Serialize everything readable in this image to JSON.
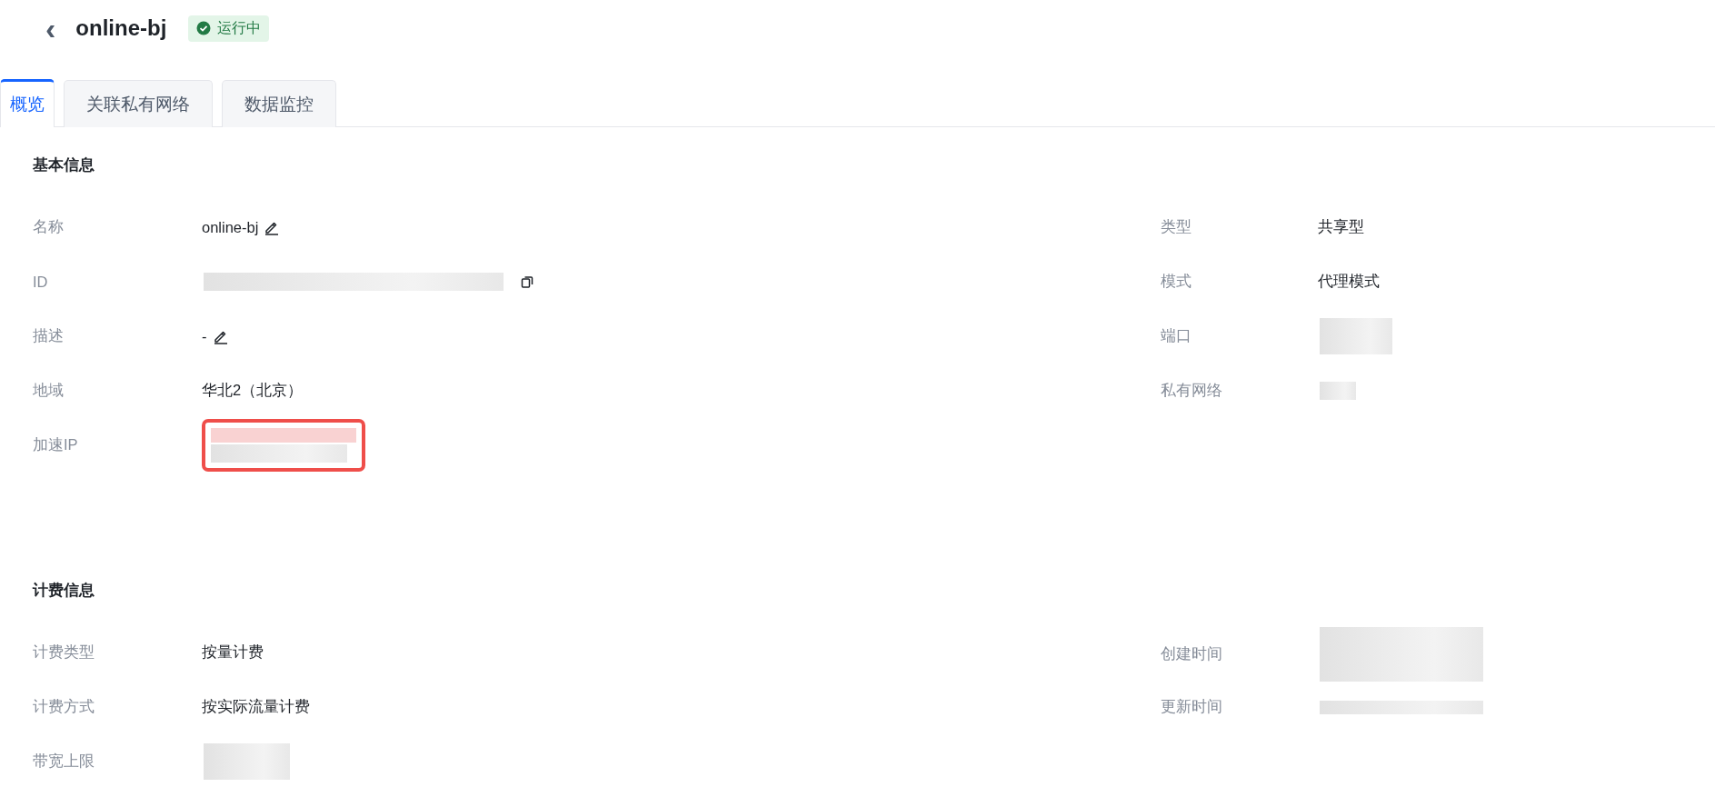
{
  "header": {
    "back": "‹",
    "title": "online-bj",
    "status": {
      "label": "运行中",
      "running": true
    }
  },
  "tabs": [
    {
      "label": "概览",
      "selected": true
    },
    {
      "label": "关联私有网络",
      "selected": false
    },
    {
      "label": "数据监控",
      "selected": false
    }
  ],
  "sections": [
    {
      "title": "基本信息",
      "left": [
        {
          "label": "名称",
          "kind": "text",
          "value": "online-bj",
          "editable": true
        },
        {
          "label": "ID",
          "kind": "redacted",
          "copyable": true
        },
        {
          "label": "描述",
          "kind": "text",
          "value": "-",
          "editable": true
        },
        {
          "label": "地域",
          "kind": "text",
          "value": "华北2（北京）"
        },
        {
          "label": "加速IP",
          "kind": "redacted",
          "highlighted": true
        }
      ],
      "right": [
        {
          "label": "类型",
          "kind": "text",
          "value": "共享型"
        },
        {
          "label": "模式",
          "kind": "text",
          "value": "代理模式"
        },
        {
          "label": "端口",
          "kind": "redacted"
        },
        {
          "label": "私有网络",
          "kind": "redacted"
        }
      ]
    },
    {
      "title": "计费信息",
      "left": [
        {
          "label": "计费类型",
          "kind": "text",
          "value": "按量计费"
        },
        {
          "label": "计费方式",
          "kind": "text",
          "value": "按实际流量计费"
        },
        {
          "label": "带宽上限",
          "kind": "redacted"
        }
      ],
      "right": [
        {
          "label": "创建时间",
          "kind": "redacted"
        },
        {
          "label": "更新时间",
          "kind": "redacted"
        }
      ]
    }
  ]
}
